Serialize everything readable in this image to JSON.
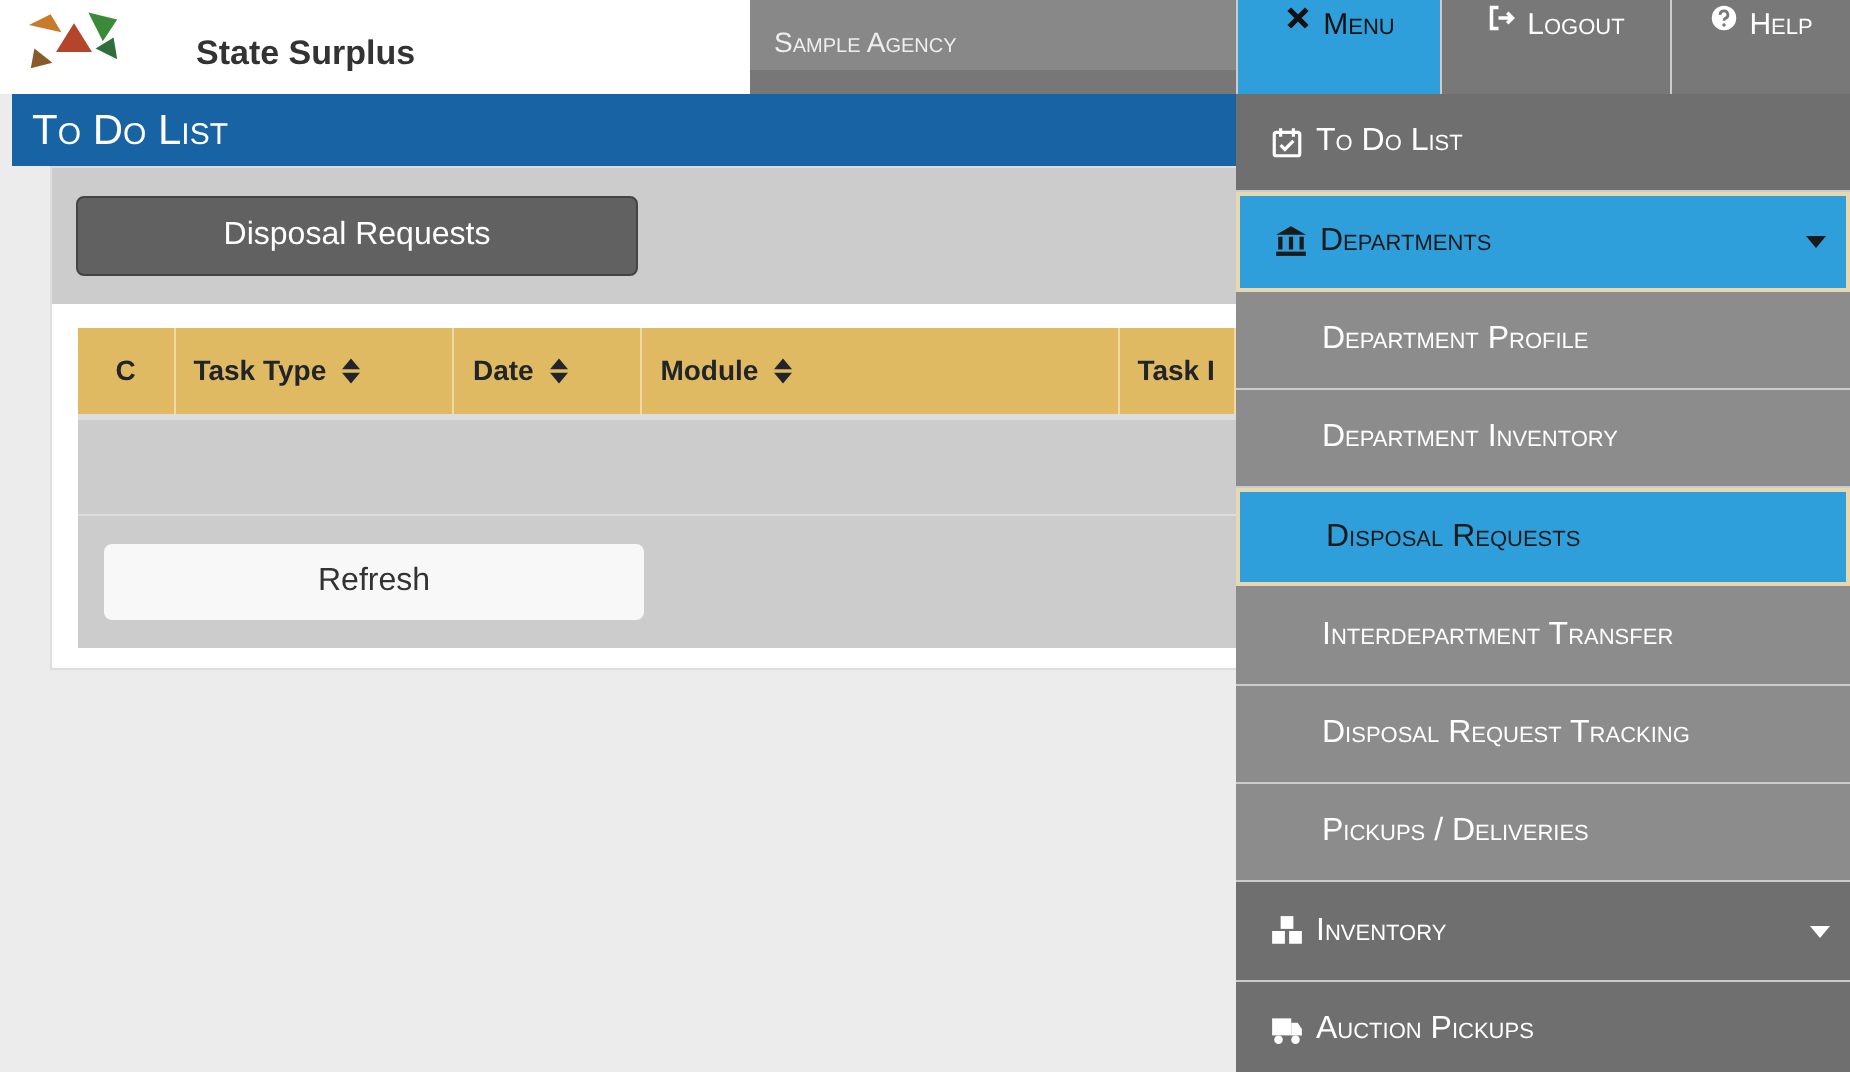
{
  "header": {
    "logo_text": "State Surplus",
    "agency": "Sample Agency",
    "buttons": [
      {
        "label": "Menu",
        "kind": "menu",
        "selected": true
      },
      {
        "label": "Logout",
        "kind": "logout",
        "selected": false
      },
      {
        "label": "Help",
        "kind": "help",
        "selected": false
      }
    ]
  },
  "page_title": "To Do List",
  "tabs": [
    {
      "label": "Disposal Requests",
      "selected": true
    }
  ],
  "table": {
    "columns": [
      {
        "label": "C",
        "sortable": false
      },
      {
        "label": "Task Type",
        "sortable": true
      },
      {
        "label": "Date",
        "sortable": true
      },
      {
        "label": "Module",
        "sortable": true
      },
      {
        "label": "Task I",
        "sortable": false
      }
    ]
  },
  "refresh_button": "Refresh",
  "menu": [
    {
      "label": "To Do List",
      "selected": false
    },
    {
      "label": "Departments",
      "selected": true,
      "expanded": true,
      "children": [
        {
          "label": "Department Profile",
          "selected": false
        },
        {
          "label": "Department Inventory",
          "selected": false
        },
        {
          "label": "Disposal Requests",
          "selected": true
        },
        {
          "label": "Interdepartment Transfer",
          "selected": false
        },
        {
          "label": "Disposal Request Tracking",
          "selected": false
        },
        {
          "label": "Pickups / Deliveries",
          "selected": false
        }
      ]
    },
    {
      "label": "Inventory",
      "selected": false,
      "expanded": false
    },
    {
      "label": "Auction Pickups",
      "selected": false
    }
  ]
}
